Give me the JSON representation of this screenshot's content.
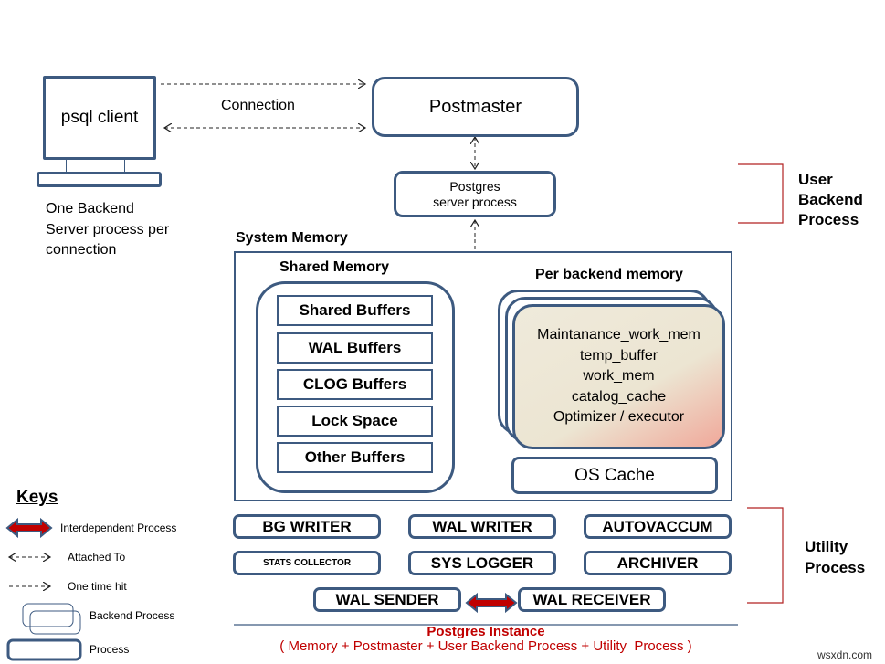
{
  "client": {
    "label": "psql client",
    "note_lines": [
      "One Backend",
      "Server process per",
      "connection"
    ]
  },
  "connection": {
    "label": "Connection"
  },
  "postmaster": {
    "label": "Postmaster"
  },
  "server_process": {
    "line1": "Postgres",
    "line2": "server process"
  },
  "user_backend": {
    "lines": [
      "User",
      "Backend",
      "Process"
    ]
  },
  "system_memory": {
    "title": "System Memory",
    "shared_memory": {
      "title": "Shared Memory",
      "buffers": [
        "Shared Buffers",
        "WAL Buffers",
        "CLOG Buffers",
        "Lock Space",
        "Other Buffers"
      ]
    },
    "per_backend": {
      "title": "Per backend memory",
      "items": [
        "Maintanance_work_mem",
        "temp_buffer",
        "work_mem",
        "catalog_cache",
        "Optimizer / executor"
      ]
    },
    "os_cache": "OS Cache"
  },
  "utility": {
    "row1": [
      "BG WRITER",
      "WAL WRITER",
      "AUTOVACCUM"
    ],
    "row2": [
      "STATS COLLECTOR",
      "SYS LOGGER",
      "ARCHIVER"
    ],
    "row3": [
      "WAL SENDER",
      "WAL RECEIVER"
    ],
    "label_lines": [
      "Utility",
      "Process"
    ]
  },
  "instance": {
    "title": "Postgres Instance",
    "subtitle": "( Memory + Postmaster + User Backend Process + Utility  Process )"
  },
  "keys": {
    "title": "Keys",
    "items": [
      "Interdependent Process",
      "Attached To",
      "One time hit",
      "Backend Process",
      "Process"
    ]
  },
  "watermark": "wsxdn.com",
  "colors": {
    "border": "#3d5a80",
    "accent_red": "#c00000",
    "bracket": "#b22222"
  }
}
